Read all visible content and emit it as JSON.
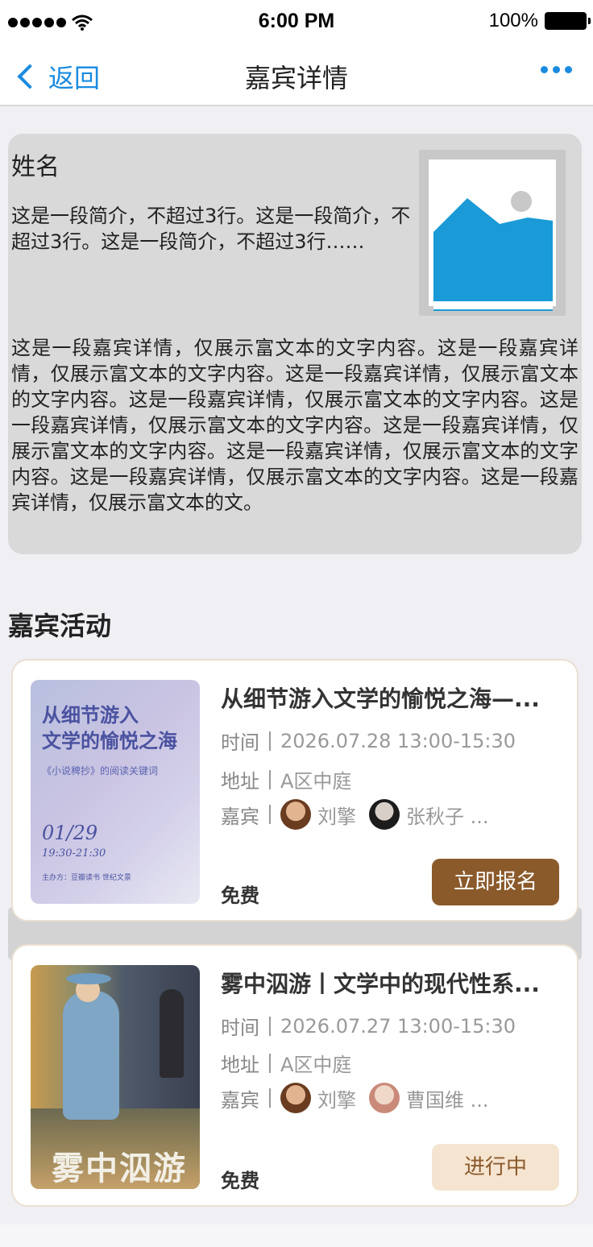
{
  "status_bar": {
    "time": "6:00 PM",
    "battery": "100%"
  },
  "nav": {
    "back_label": "返回",
    "title": "嘉宾详情",
    "more_icon": "more-dots-icon",
    "accent_color": "#1a8be0"
  },
  "guest": {
    "name": "姓名",
    "brief": "这是一段简介，不超过3行。这是一段简介，不超过3行。这是一段简介，不超过3行……",
    "detail": "这是一段嘉宾详情，仅展示富文本的文字内容。这是一段嘉宾详情，仅展示富文本的文字内容。这是一段嘉宾详情，仅展示富文本的文字内容。这是一段嘉宾详情，仅展示富文本的文字内容。这是一段嘉宾详情，仅展示富文本的文字内容。这是一段嘉宾详情，仅展示富文本的文字内容。这是一段嘉宾详情，仅展示富文本的文字内容。这是一段嘉宾详情，仅展示富文本的文字内容。这是一段嘉宾详情，仅展示富文本的文。"
  },
  "activities_section": {
    "title": "嘉宾活动",
    "items": [
      {
        "title": "从细节游入文学的愉悦之海—...",
        "time_label": "时间",
        "time": "2026.07.28 13:00-15:30",
        "address_label": "地址",
        "address": "A区中庭",
        "guests_label": "嘉宾",
        "guests": [
          "刘擎",
          "张秋子 ..."
        ],
        "price": "免费",
        "button": "立即报名",
        "button_style": "primary",
        "cover": {
          "line1": "从细节游入",
          "line2": "文学的愉悦之海",
          "subtitle": "《小说稗抄》的阅读关键词",
          "date": "01/29",
          "time": "19:30-21:30",
          "organizer": "主办方：豆瓣读书 世纪文景"
        }
      },
      {
        "title": "雾中泅游丨文学中的现代性系...",
        "time_label": "时间",
        "time": "2026.07.27 13:00-15:30",
        "address_label": "地址",
        "address": "A区中庭",
        "guests_label": "嘉宾",
        "guests": [
          "刘擎",
          "曹国维 ..."
        ],
        "price": "免费",
        "button": "进行中",
        "button_style": "secondary",
        "cover": {
          "title": "雾中泅游"
        }
      }
    ]
  },
  "colors": {
    "primary_button": "#8b5a2b",
    "secondary_button_bg": "#f5e4d0",
    "card_border": "#eadfd2",
    "guest_card_bg": "#d9d9d9",
    "image_placeholder": "#1a9ad6"
  }
}
